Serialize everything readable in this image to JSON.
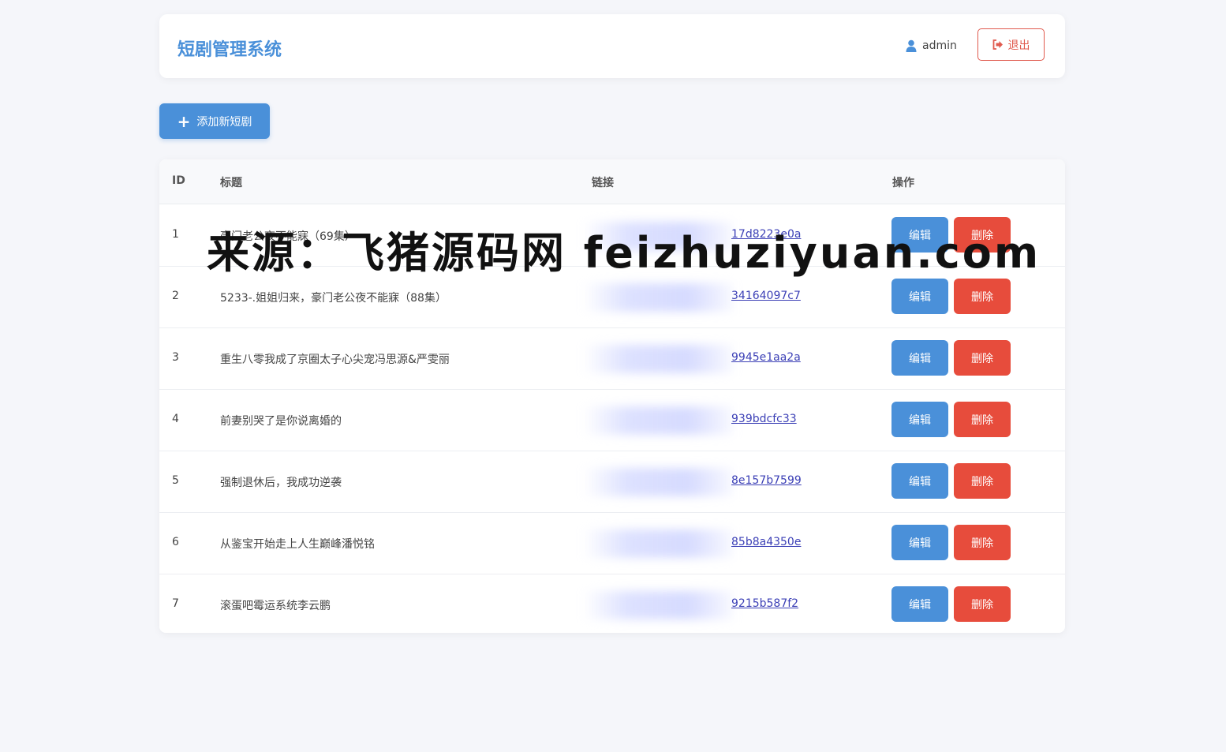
{
  "header": {
    "brand": "短剧管理系统",
    "user": "admin",
    "logout_label": "退出"
  },
  "toolbar": {
    "add_label": "添加新短剧"
  },
  "table": {
    "columns": [
      "ID",
      "标题",
      "链接",
      "操作"
    ],
    "rows": [
      {
        "id": "1",
        "title": "豪门老公夜不能寐（69集）",
        "link": "17d8223e0a"
      },
      {
        "id": "2",
        "title": "5233-.姐姐归来，豪门老公夜不能寐（88集）",
        "link": "34164097c7"
      },
      {
        "id": "3",
        "title": "重生八零我成了京圈太子心尖宠冯思源&严雯丽",
        "link": "9945e1aa2a"
      },
      {
        "id": "4",
        "title": "前妻别哭了是你说离婚的",
        "link": "939bdcfc33"
      },
      {
        "id": "5",
        "title": "强制退休后，我成功逆袭",
        "link": "8e157b7599"
      },
      {
        "id": "6",
        "title": "从鉴宝开始走上人生巅峰潘悦铭",
        "link": "85b8a4350e"
      },
      {
        "id": "7",
        "title": "滚蛋吧霉运系统李云鹏",
        "link": "9215b587f2"
      }
    ],
    "edit_label": "编辑",
    "delete_label": "删除"
  },
  "watermark": "来源：飞猪源码网 feizhuziyuan.com",
  "colors": {
    "primary": "#4a90d9",
    "danger": "#e74c3c",
    "link": "#3b3fb6",
    "background": "#f5f6fa"
  }
}
